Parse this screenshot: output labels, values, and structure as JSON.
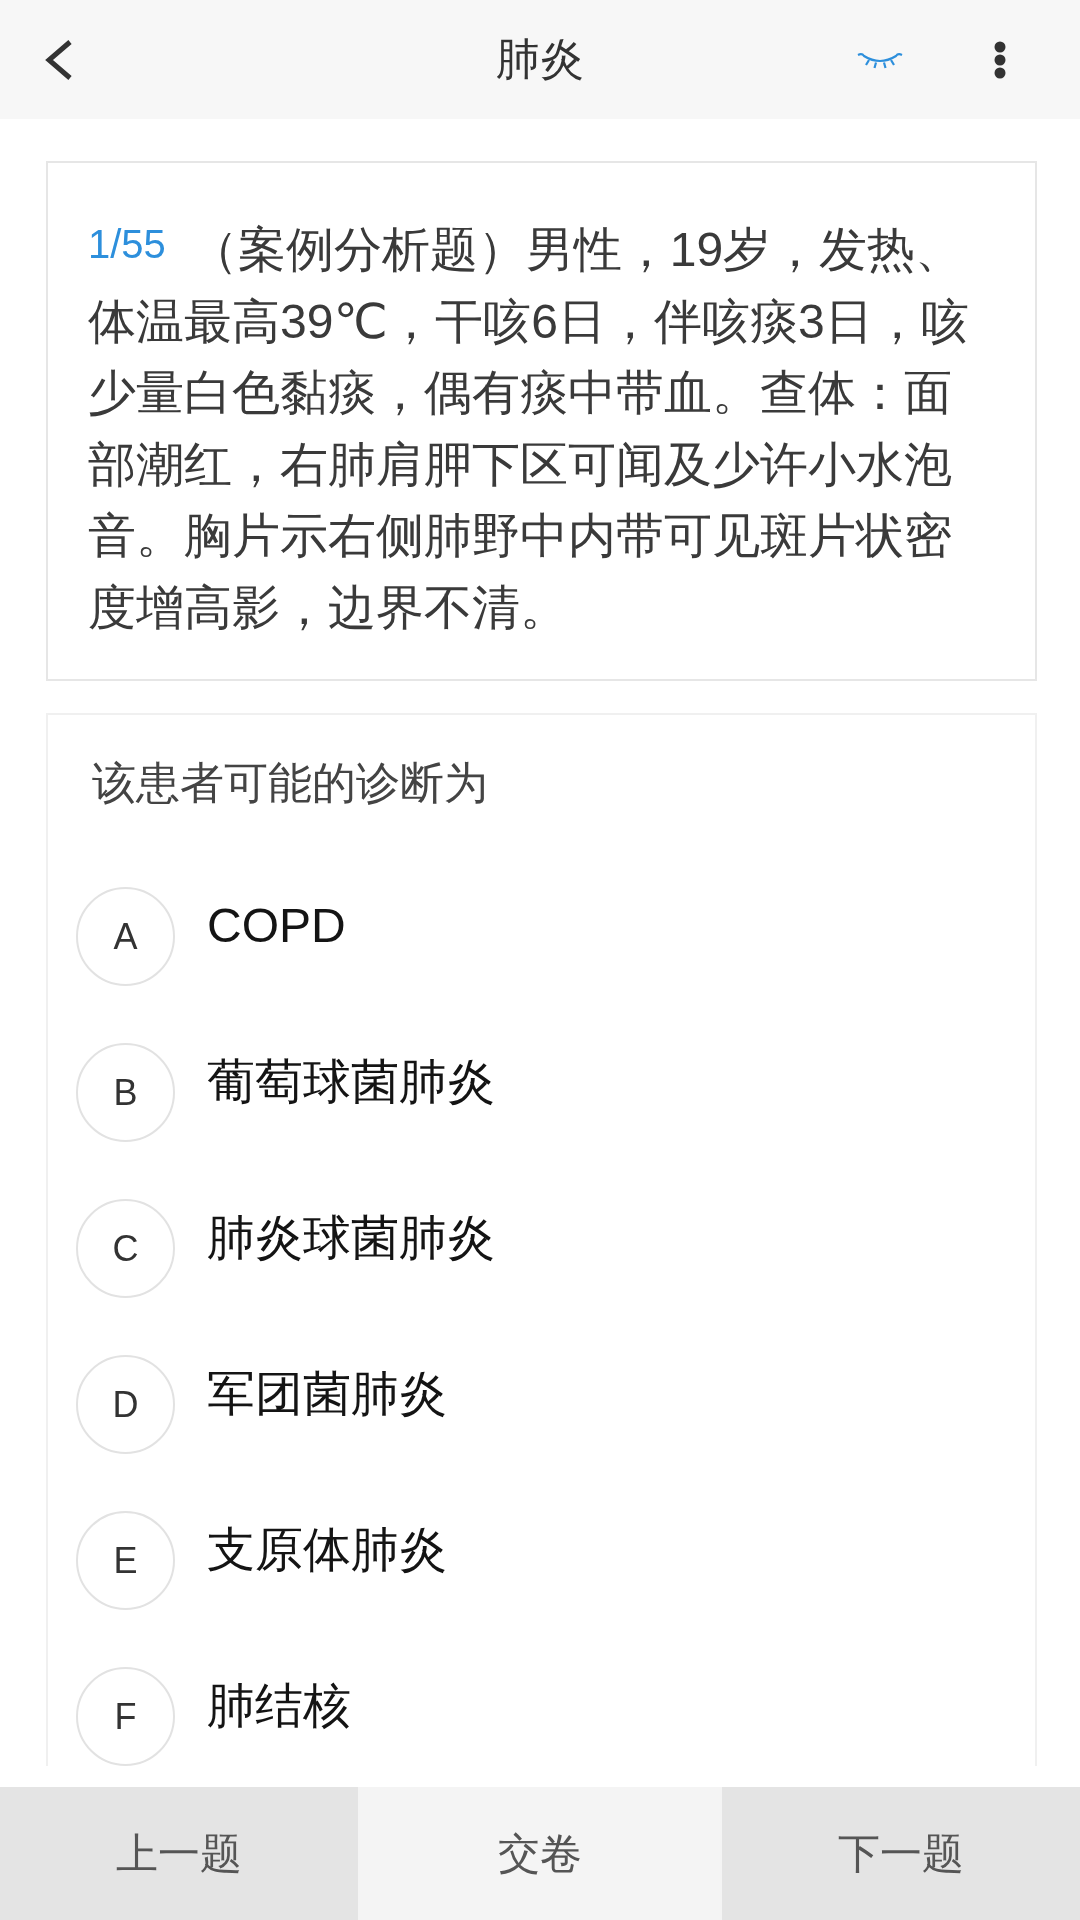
{
  "header": {
    "title": "肺炎"
  },
  "question": {
    "number": "1/55",
    "text": "（案例分析题）男性，19岁，发热、体温最高39℃，干咳6日，伴咳痰3日，咳少量白色黏痰，偶有痰中带血。查体：面部潮红，右肺肩胛下区可闻及少许小水泡音。胸片示右侧肺野中内带可见斑片状密度增高影，边界不清。"
  },
  "sub_question": {
    "prompt": "该患者可能的诊断为",
    "options": [
      {
        "letter": "A",
        "text": "COPD",
        "selected": false
      },
      {
        "letter": "B",
        "text": "葡萄球菌肺炎",
        "selected": false
      },
      {
        "letter": "C",
        "text": "肺炎球菌肺炎",
        "selected": false
      },
      {
        "letter": "D",
        "text": "军团菌肺炎",
        "selected": false
      },
      {
        "letter": "E",
        "text": "支原体肺炎",
        "selected": false
      },
      {
        "letter": "F",
        "text": "肺结核",
        "selected": false
      }
    ]
  },
  "bottom_bar": {
    "buttons": [
      {
        "label": "上一题",
        "kind": "nav"
      },
      {
        "label": "交卷",
        "kind": "submit"
      },
      {
        "label": "下一题",
        "kind": "nav"
      }
    ]
  }
}
